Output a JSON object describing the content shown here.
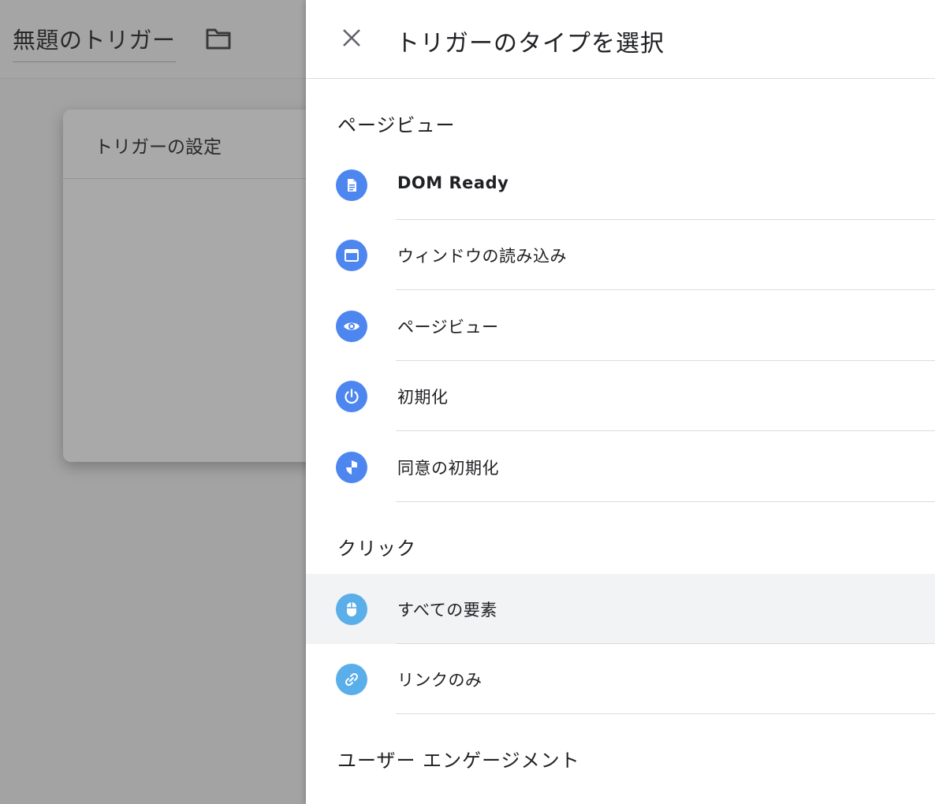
{
  "editor": {
    "title": "無題のトリガー",
    "card_title": "トリガーの設定"
  },
  "panel": {
    "title": "トリガーのタイプを選択",
    "sections": [
      {
        "title": "ページビュー",
        "items": [
          {
            "label": "DOM Ready",
            "icon": "document-icon"
          },
          {
            "label": "ウィンドウの読み込み",
            "icon": "window-icon"
          },
          {
            "label": "ページビュー",
            "icon": "eye-icon"
          },
          {
            "label": "初期化",
            "icon": "power-icon"
          },
          {
            "label": "同意の初期化",
            "icon": "shield-icon"
          }
        ]
      },
      {
        "title": "クリック",
        "items": [
          {
            "label": "すべての要素",
            "icon": "mouse-icon"
          },
          {
            "label": "リンクのみ",
            "icon": "link-icon"
          }
        ]
      },
      {
        "title": "ユーザー エンゲージメント",
        "items": []
      }
    ]
  },
  "colors": {
    "icon_blue": "#4e86f0",
    "icon_light_blue": "#5aaee9",
    "highlight_row": "#f1f3f4",
    "overlay": "#a3a3a3"
  }
}
